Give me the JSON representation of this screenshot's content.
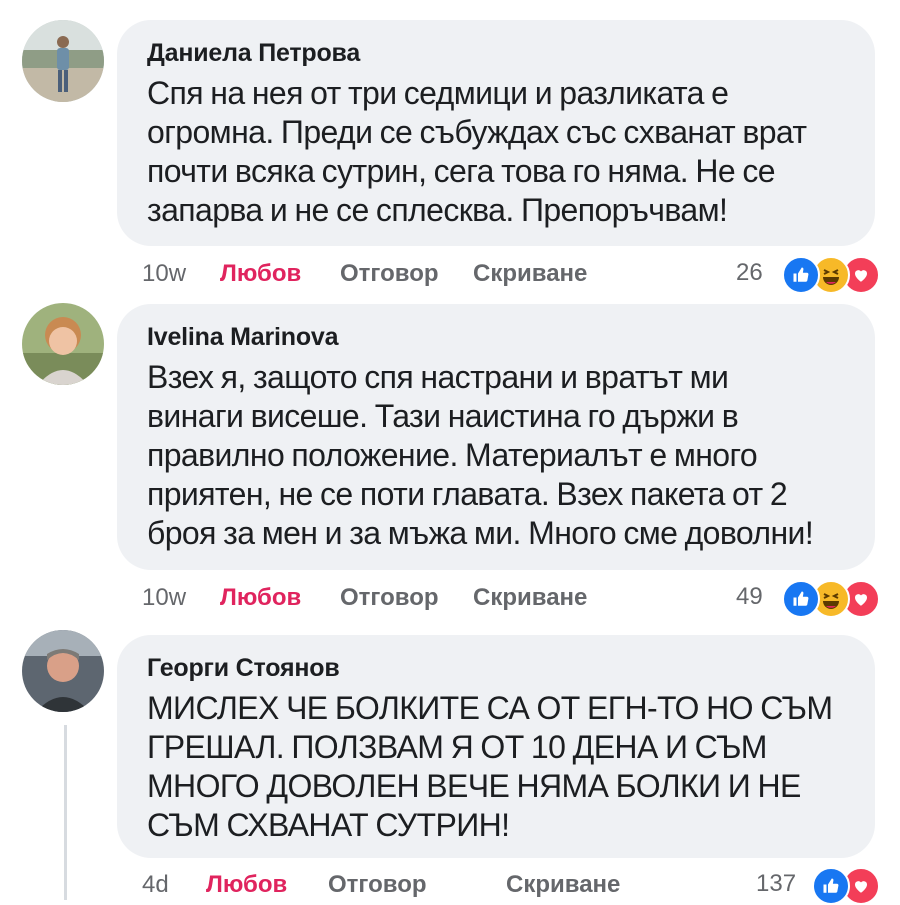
{
  "comments": [
    {
      "author": "Даниела Петрова",
      "lines": [
        "Спя на нея от три седмици и разликата е",
        "огромна. Преди се събуждах със схванат врат",
        "почти всяка сутрин, сега това го няма. Не се",
        "запарва и не се сплесква. Препоръчвам!"
      ],
      "time": "10w",
      "love": "Любов",
      "reply": "Отговор",
      "hide": "Скриване",
      "reaction_count": "26",
      "reactions": [
        "like-icon",
        "haha-icon",
        "love-icon"
      ]
    },
    {
      "author": "Ivelina Marinova",
      "lines": [
        "Взех я, защото спя настрани и вратът ми",
        "винаги висеше. Тази наистина го държи в",
        "правилно положение. Материалът е много",
        "приятен, не се поти главата. Взех пакета от 2",
        "броя за мен и за мъжа ми. Много сме доволни!"
      ],
      "time": "10w",
      "love": "Любов",
      "reply": "Отговор",
      "hide": "Скриване",
      "reaction_count": "49",
      "reactions": [
        "like-icon",
        "haha-icon",
        "love-icon"
      ]
    },
    {
      "author": "Георги Стоянов",
      "lines": [
        "МИСЛЕХ ЧЕ БОЛКИТЕ СА ОТ ЕГН-ТО НО СЪМ",
        "ГРЕШАЛ. ПОЛЗВАМ Я ОТ 10 ДЕНА И СЪМ",
        "МНОГО ДОВОЛЕН ВЕЧЕ НЯМА БОЛКИ И НЕ",
        "СЪМ СХВАНАТ СУТРИН!"
      ],
      "time": "4d",
      "love": "Любов",
      "reply": "Отговор",
      "hide": "Скриване",
      "reaction_count": "137",
      "reactions": [
        "like-icon",
        "love-icon"
      ]
    }
  ],
  "colors": {
    "bubble": "#eff1f4",
    "love_text": "#e0245e",
    "meta_text": "#65676b",
    "like": "#1877f2",
    "haha": "#f7b928",
    "love": "#f33e58"
  }
}
